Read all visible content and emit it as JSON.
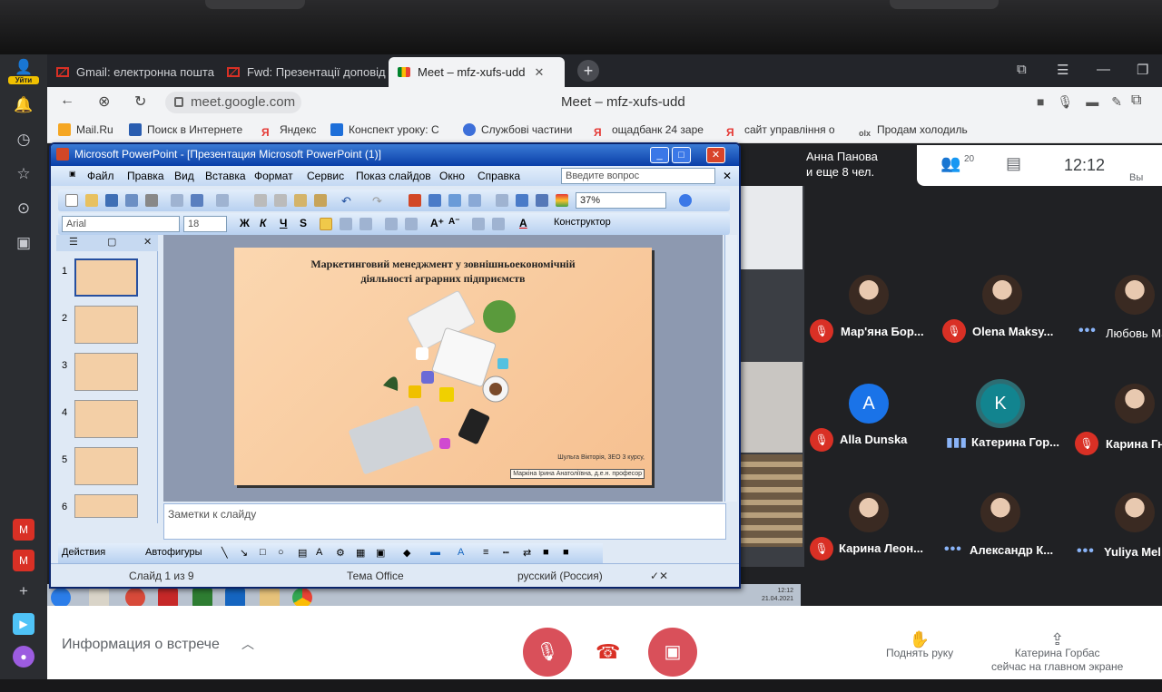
{
  "browser": {
    "side_badge": "Уйти",
    "tabs": [
      {
        "label": "Gmail: електронна пошта"
      },
      {
        "label": "Fwd: Презентації доповід"
      },
      {
        "label": "Meet – mfz-xufs-udd"
      }
    ],
    "url": "meet.google.com",
    "page_title": "Meet – mfz-xufs-udd",
    "bookmarks": [
      "Mail.Ru",
      "Поиск в Интернете",
      "Яндекс",
      "Конспект уроку: С",
      "Службові частини",
      "ощадбанк 24 заре",
      "сайт управління о",
      "Продам холодиль"
    ]
  },
  "meet": {
    "header_name": "Анна Панова",
    "header_more": "и еще 8 чел.",
    "participants_count": "20",
    "clock": "12:12",
    "you_label": "Вы",
    "tiles": [
      {
        "name": "Мар'яна Бор...",
        "state": "muted"
      },
      {
        "name": "Olena Maksy...",
        "state": "muted"
      },
      {
        "name": "Любовь Ма",
        "state": "dots"
      },
      {
        "name": "Alla Dunska",
        "state": "muted",
        "letter": "A"
      },
      {
        "name": "Катерина Гор...",
        "state": "speaking",
        "letter": "K"
      },
      {
        "name": "Карина Гн",
        "state": "muted"
      },
      {
        "name": "Карина Леон...",
        "state": "muted"
      },
      {
        "name": "Александр К...",
        "state": "dots"
      },
      {
        "name": "Yuliya Mel",
        "state": "dots"
      }
    ],
    "info_label": "Информация о встрече",
    "raise_hand": "Поднять руку",
    "presenter_line1": "Катерина Горбас",
    "presenter_line2": "сейчас на главном экране"
  },
  "taskbar": {
    "time": "12:12",
    "date": "21.04.2021"
  },
  "ppt": {
    "title": "Microsoft PowerPoint - [Презентация Microsoft PowerPoint (1)]",
    "menu": [
      "Файл",
      "Правка",
      "Вид",
      "Вставка",
      "Формат",
      "Сервис",
      "Показ слайдов",
      "Окно",
      "Справка"
    ],
    "ask_placeholder": "Введите вопрос",
    "zoom": "37%",
    "font": "Arial",
    "font_size": "18",
    "fmt_buttons": [
      "Ж",
      "К",
      "Ч",
      "S"
    ],
    "designer": "Конструктор",
    "slide_numbers": [
      "1",
      "2",
      "3",
      "4",
      "5",
      "6"
    ],
    "slide_title": "Маркетинговий менеджмент у зовнішньоекономічній діяльності аграрних підприємств",
    "slide_author": "Шульга Вікторія, 3ЕО 3 курсу,",
    "slide_supervisor": "Маркіна Ірина Анатоліївна, д.е.н. професор",
    "notes_placeholder": "Заметки к слайду",
    "draw_actions": "Действия",
    "draw_autoshapes": "Автофигуры",
    "status_slide": "Слайд 1 из 9",
    "status_theme": "Тема Office",
    "status_lang": "русский (Россия)"
  },
  "colors": {
    "meet_bg": "#202124",
    "mute_red": "#d93025",
    "ctrl_red": "#d9505a",
    "ppt_blue": "#0a3ea8",
    "slide_peach": "#f6c090"
  }
}
